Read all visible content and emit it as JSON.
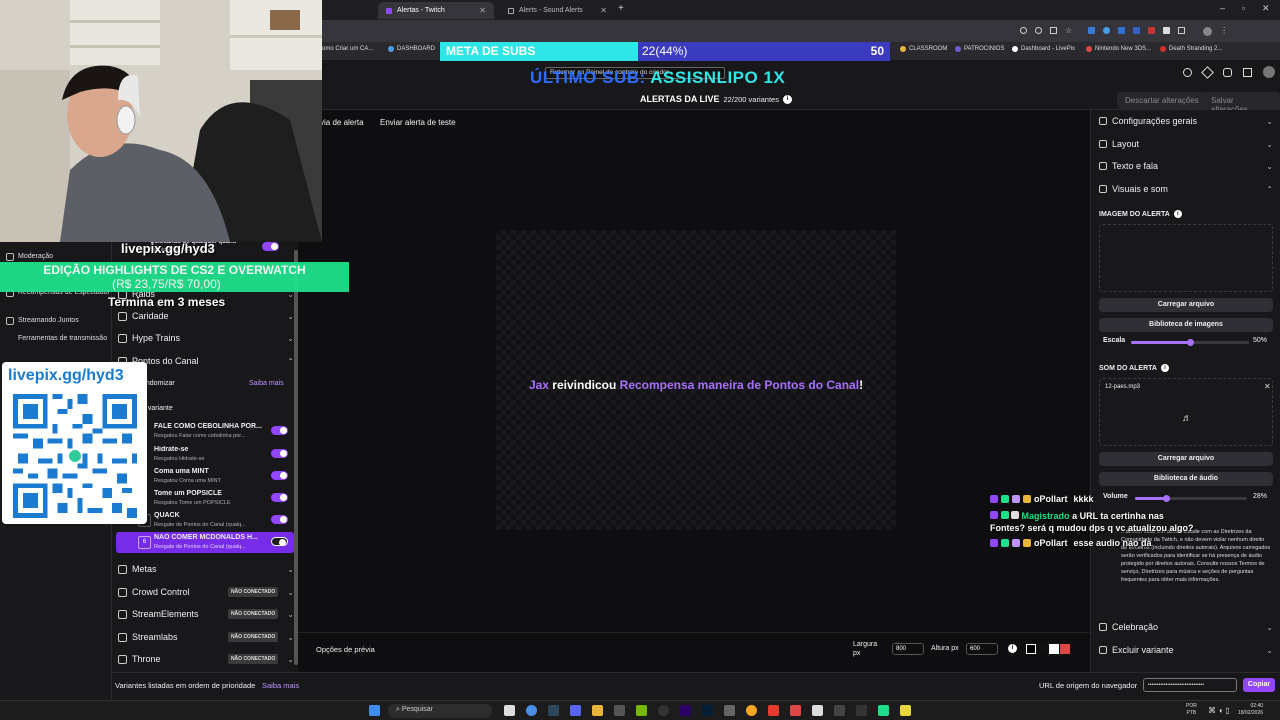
{
  "browser": {
    "tabs": [
      {
        "label": "Alertas - Twitch",
        "active": true
      },
      {
        "label": "Alerts - Sound Alerts",
        "active": false
      }
    ],
    "new_tab": "+",
    "bookmarks": [
      "omo Criar um CA...",
      "DASHBOARD",
      "CLASSROOM",
      "PATROCINIOS",
      "Dashboard - LivePix",
      "Nintendo New 3DS...",
      "Death Stranding 2..."
    ]
  },
  "overlay": {
    "meta_label": "META DE SUBS",
    "meta_value": "22(44%)",
    "meta_goal": "50",
    "meta_fraction": 0.44,
    "ultimo_prefix": "ÚLTIMO SUB:",
    "ultimo_name": "ASSISNLIPO 1X",
    "livepix_top": "livepix.gg/hyd3",
    "edicao_line1": "EDIÇÃO HIGHLIGHTS DE CS2 E OVERWATCH",
    "edicao_line2": "(R$ 23,75/R$ 70,00)",
    "termina": "Termina em 3 meses",
    "qr_text": "livepix.gg/hyd3",
    "tooltip_text": "Retornar ao Painel de controle do criador"
  },
  "header": {
    "title": "ALERTAS DA LIVE",
    "variants": "22/200 variantes",
    "discard": "Descartar alterações",
    "save": "Salvar alterações"
  },
  "toolbar": {
    "preview_label": "via de alerta",
    "send_test": "Enviar alerta de teste"
  },
  "leftnav": [
    {
      "label": "Moderação"
    },
    {
      "label": "Recompensas de Espectador"
    },
    {
      "label": "Streamando Juntos"
    },
    {
      "label": "Ferramentas de transmissão"
    }
  ],
  "midlist": {
    "partial_top_title": "Colocando de qualquer quanti",
    "partial_top_sub": "Inscrito(a) com bits via Cheer",
    "raids": "Raids",
    "caridade": "Caridade",
    "hype": "Hype Trains",
    "pontos": "Pontos do Canal",
    "randomizar": "andomizar",
    "saiba": "Saiba mais",
    "variante": "a variante",
    "rows": [
      {
        "title": "FALE COMO CEBOLINHA POR...",
        "sub": "Resgatou Falar como cebolinha por..."
      },
      {
        "title": "Hidrate-se",
        "sub": "Resgatou Hidrate-se"
      },
      {
        "title": "Coma uma MINT",
        "sub": "Resgatou Coma uma MINT"
      },
      {
        "title": "Tome um POPSICLE",
        "sub": "Resgatou Tome um POPSICLE"
      },
      {
        "title": "QUACK",
        "sub": "Resgate de Pontos do Canal (qualq..."
      },
      {
        "title": "NÃO COMER MCDONALDS H...",
        "sub": "Resgate de Pontos do Canal (qualq...",
        "num": "6"
      }
    ],
    "metas": "Metas",
    "crowd": "Crowd Control",
    "se": "StreamElements",
    "sl": "Streamlabs",
    "throne": "Throne",
    "not_connected": "NÃO CONECTADO"
  },
  "preview": {
    "alert_user": "Jax",
    "alert_mid": " reivindicou ",
    "alert_reward": "Recompensa maneira de Pontos do Canal",
    "alert_end": "!"
  },
  "bottombar": {
    "options": "Opções de prévia",
    "width_label": "Largura px",
    "width_value": "800",
    "height_label": "Altura px",
    "height_value": "600"
  },
  "footer": {
    "priority": "Variantes listadas em ordem de prioridade",
    "saiba": "Saiba mais",
    "url_label": "URL de origem do navegador",
    "url_value": "••••••••••••••••••••••••••••••••",
    "copy": "Copiar"
  },
  "rpanel": {
    "config": "Configurações gerais",
    "layout": "Layout",
    "texto": "Texto e fala",
    "visuais": "Visuais e som",
    "imagem": "IMAGEM DO ALERTA",
    "carregar": "Carregar arquivo",
    "biblioteca_img": "Biblioteca de imagens",
    "escala": "Escala",
    "escala_val": "50%",
    "escala_fraction": 0.5,
    "som": "SOM DO ALERTA",
    "file": "12-paes.mp3",
    "carregar2": "Carregar arquivo",
    "biblioteca_aud": "Biblioteca de áudio",
    "volume": "Volume",
    "volume_val": "28%",
    "volume_fraction": 0.28,
    "disclaimer": "...devem estar em conformidade com as Diretrizes da Comunidade da Twitch, e não devem violar nenhum direito de terceiros (incluindo direitos autorais). Arquivos carregados serão verificados para identificar se há presença de áudio protegido por direitos autorais. Consulte nossos Termos de serviço, Diretrizes para música e seções de perguntas frequentes para obter mais informações.",
    "celebracao": "Celebração",
    "excluir": "Excluir variante"
  },
  "chat": [
    {
      "user": "oPollart",
      "user_color": "#ffffff",
      "msg": "kkkk"
    },
    {
      "user": "Magistrado",
      "user_color": "#1ee08b",
      "msg": "a URL ta certinha nas Fontes? será q mudou dps q vc atualizou algo?"
    },
    {
      "user": "oPollart",
      "user_color": "#ffffff",
      "msg": "esse audio nao da"
    }
  ],
  "taskbar": {
    "search": "Pesquisar",
    "lang1": "POR",
    "lang2": "PTB",
    "time": "02:40",
    "date": "18/02/2026"
  }
}
